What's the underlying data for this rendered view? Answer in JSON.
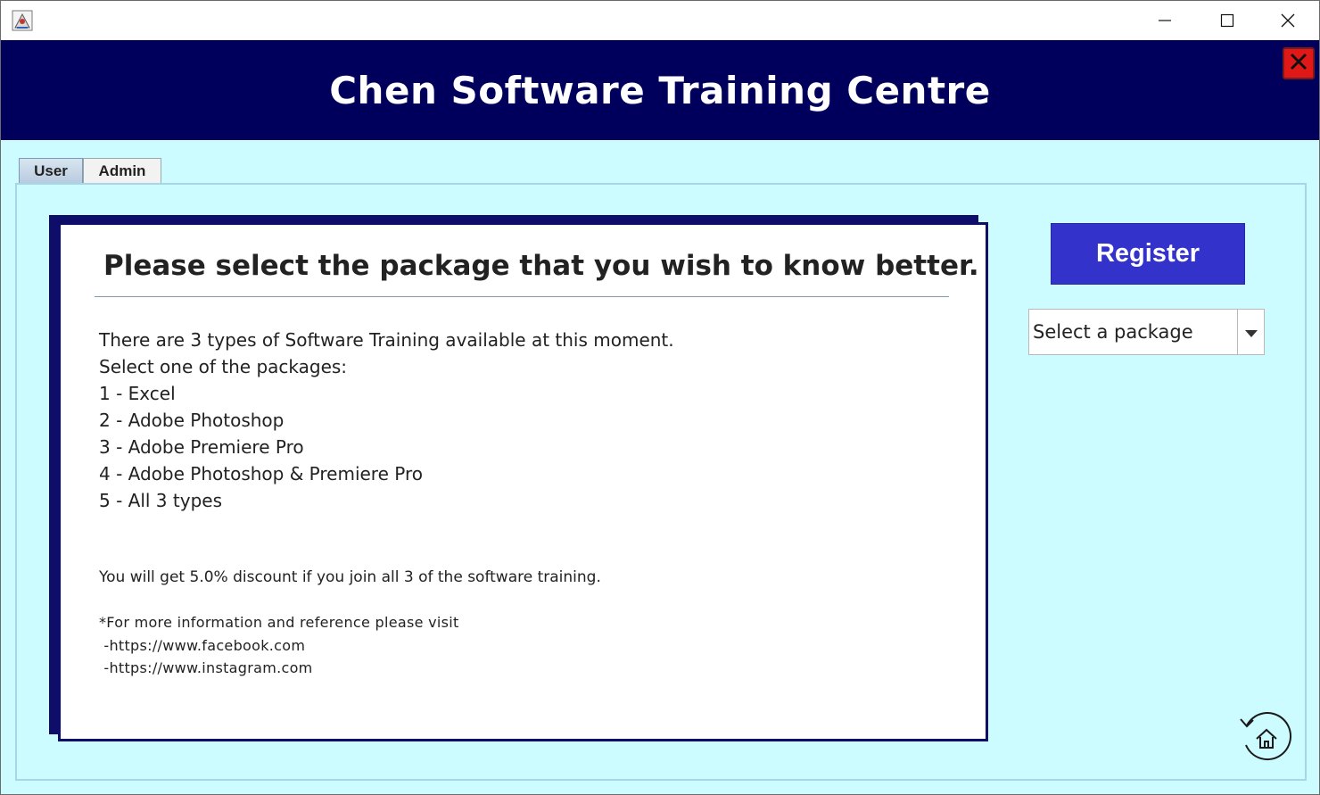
{
  "window": {
    "icons": {
      "app": "java-app-icon",
      "minimize": "minimize-icon",
      "maximize": "maximize-icon",
      "close": "close-icon"
    }
  },
  "banner": {
    "title": "Chen Software Training Centre",
    "close_icon": "red-close-icon"
  },
  "tabs": [
    {
      "label": "User",
      "selected": true
    },
    {
      "label": "Admin",
      "selected": false
    }
  ],
  "card": {
    "heading": "Please select the package that you wish to know better.",
    "lines": [
      "There are 3 types of Software Training available at this moment.",
      "Select one of the packages:",
      "1 - Excel",
      "2 - Adobe Photoshop",
      "3 - Adobe Premiere Pro",
      "4 - Adobe Photoshop & Premiere Pro",
      "5 - All 3 types"
    ],
    "discount": "You will get 5.0% discount if you join all 3 of the software training.",
    "info": [
      "*For more information and reference please visit",
      " -https://www.facebook.com",
      " -https://www.instagram.com"
    ]
  },
  "register": {
    "label": "Register"
  },
  "package_select": {
    "value": "Select a package"
  },
  "home": {
    "icon": "home-refresh-icon"
  },
  "colors": {
    "banner": "#00005c",
    "content_bg": "#ccfcff",
    "card_border": "#0e0e6a",
    "register_bg": "#3333cc",
    "close_red": "#e01818"
  }
}
